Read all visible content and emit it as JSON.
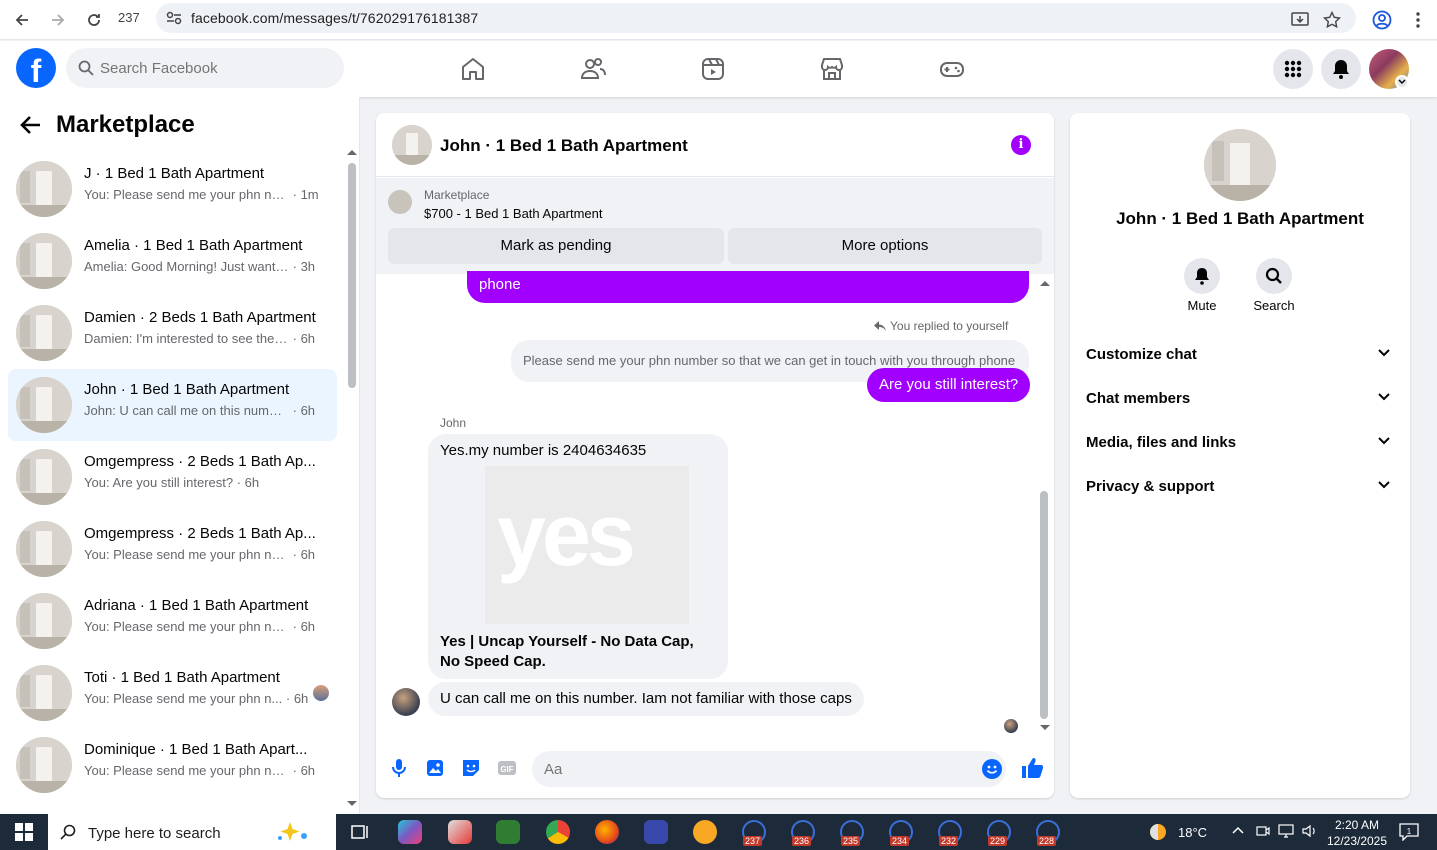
{
  "browser": {
    "tab_count": "237",
    "url": "facebook.com/messages/t/762029176181387"
  },
  "fb_header": {
    "search_placeholder": "Search Facebook"
  },
  "left_panel": {
    "title": "Marketplace",
    "conversations": [
      {
        "name": "J · 1 Bed 1 Bath Apartment",
        "preview": "You: Please send me your phn nu...",
        "time": "· 1m",
        "active": false
      },
      {
        "name": "Amelia · 1 Bed 1 Bath Apartment",
        "preview": "Amelia: Good Morning! Just wante...",
        "time": "· 3h",
        "active": false
      },
      {
        "name": "Damien · 2 Beds 1 Bath Apartment",
        "preview": "Damien: I'm interested to see the a...",
        "time": "· 6h",
        "active": false
      },
      {
        "name": "John · 1 Bed 1 Bath Apartment",
        "preview": "John: U can call me on this number...",
        "time": "· 6h",
        "active": true
      },
      {
        "name": "Omgempress · 2 Beds 1 Bath Ap...",
        "preview": "You: Are you still interest?",
        "time": "· 6h",
        "active": false
      },
      {
        "name": "Omgempress · 2 Beds 1 Bath Ap...",
        "preview": "You: Please send me your phn num...",
        "time": "· 6h",
        "active": false
      },
      {
        "name": "Adriana · 1 Bed 1 Bath Apartment",
        "preview": "You: Please send me your phn num...",
        "time": "· 6h",
        "active": false
      },
      {
        "name": "Toti · 1 Bed 1 Bath Apartment",
        "preview": "You: Please send me your phn n...",
        "time": "· 6h",
        "active": false
      },
      {
        "name": "Dominique · 1 Bed 1 Bath Apart...",
        "preview": "You: Please send me your phn num...",
        "time": "· 6h",
        "active": false
      }
    ]
  },
  "chat": {
    "title": "John · 1 Bed 1 Bath Apartment",
    "marketplace_label": "Marketplace",
    "listing": "$700 - 1 Bed 1 Bath Apartment",
    "mark_pending_label": "Mark as pending",
    "more_options_label": "More options",
    "messages": {
      "out_partial": "phone",
      "replied_note": "You replied to yourself",
      "quoted": "Please send me your phn number so that we can get in touch with you through phone",
      "out_last": "Are you still interest?",
      "sender": "John",
      "in_number": "Yes.my number is 2404634635",
      "link_image_text": "yes",
      "link_title": "Yes | Uncap Yourself - No Data Cap, No Speed Cap.",
      "in_last": "U can call me on this number. Iam not familiar with those caps"
    },
    "composer_placeholder": "Aa"
  },
  "right_panel": {
    "name": "John · 1 Bed 1 Bath Apartment",
    "mute_label": "Mute",
    "search_label": "Search",
    "sections": [
      "Customize chat",
      "Chat members",
      "Media, files and links",
      "Privacy & support"
    ]
  },
  "taskbar": {
    "search_text": "Type here to search",
    "badges": [
      "237",
      "236",
      "235",
      "234",
      "232",
      "229",
      "228"
    ],
    "temperature": "18°C",
    "time": "2:20 AM",
    "date": "12/23/2025"
  },
  "colors": {
    "accent": "#a100ff",
    "fb_blue": "#0866ff",
    "active_row": "#ebf5ff"
  }
}
